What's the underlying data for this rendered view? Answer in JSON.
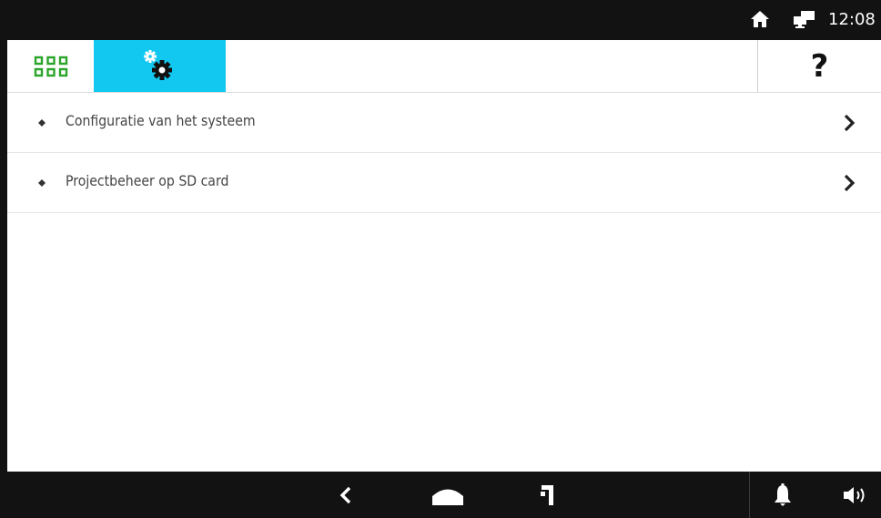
{
  "status_bar": {
    "time": "12:08",
    "icons": [
      "home-icon",
      "network-icon"
    ]
  },
  "toolbar": {
    "apps_icon": "grid-icon",
    "active_tab_icon": "settings-gear-icon",
    "help_label": "?"
  },
  "menu": {
    "items": [
      {
        "label": "Configuratie van het systeem",
        "icon": "bullet-diamond-icon",
        "trailing": "chevron-right-icon"
      },
      {
        "label": "Projectbeheer op SD card",
        "icon": "bullet-diamond-icon",
        "trailing": "chevron-right-icon"
      }
    ]
  },
  "nav_bar": {
    "icons": [
      "back-icon",
      "home-icon",
      "recent-apps-icon",
      "bell-icon",
      "volume-icon"
    ]
  },
  "colors": {
    "accent": "#12c8f0",
    "apps_green": "#2aa52a",
    "bar_dark": "#121212",
    "text": "#444444"
  }
}
